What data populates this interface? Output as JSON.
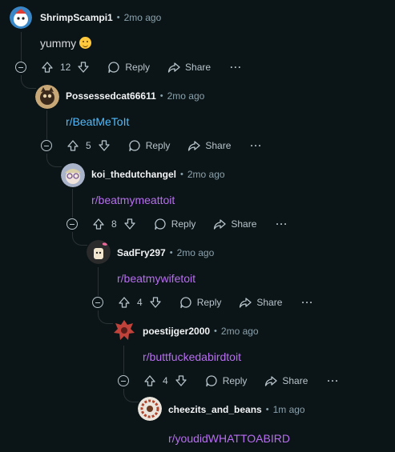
{
  "comments": [
    {
      "username": "ShrimpScampi1",
      "time": "2mo ago",
      "body": "yummy",
      "emoji": "yum-face-emoji",
      "score": "12",
      "reply": "Reply",
      "share": "Share",
      "more": "···",
      "body_color": "#d7dadc"
    },
    {
      "username": "Possessedcat66611",
      "time": "2mo ago",
      "body": "r/BeatMeToIt",
      "score": "5",
      "reply": "Reply",
      "share": "Share",
      "more": "···",
      "body_color": "#4fbcff"
    },
    {
      "username": "koi_thedutchangel",
      "time": "2mo ago",
      "body": "r/beatmymeattoit",
      "score": "8",
      "reply": "Reply",
      "share": "Share",
      "more": "···",
      "body_color": "#b86ef2"
    },
    {
      "username": "SadFry297",
      "time": "2mo ago",
      "body": "r/beatmywifetoit",
      "score": "4",
      "reply": "Reply",
      "share": "Share",
      "more": "···",
      "body_color": "#b86ef2"
    },
    {
      "username": "poestijger2000",
      "time": "2mo ago",
      "body": "r/buttfuckedabirdtoit",
      "score": "4",
      "reply": "Reply",
      "share": "Share",
      "more": "···",
      "body_color": "#b86ef2"
    },
    {
      "username": "cheezits_and_beans",
      "time": "1m ago",
      "body": "r/youdidWHATTOABIRD",
      "body_color": "#b86ef2"
    }
  ],
  "separator": "•",
  "colors": {
    "background": "#0b1416",
    "link_blue": "#4fbcff",
    "link_visited": "#b86ef2",
    "meta": "#8ba2ad",
    "thread_line": "#2a3236"
  }
}
